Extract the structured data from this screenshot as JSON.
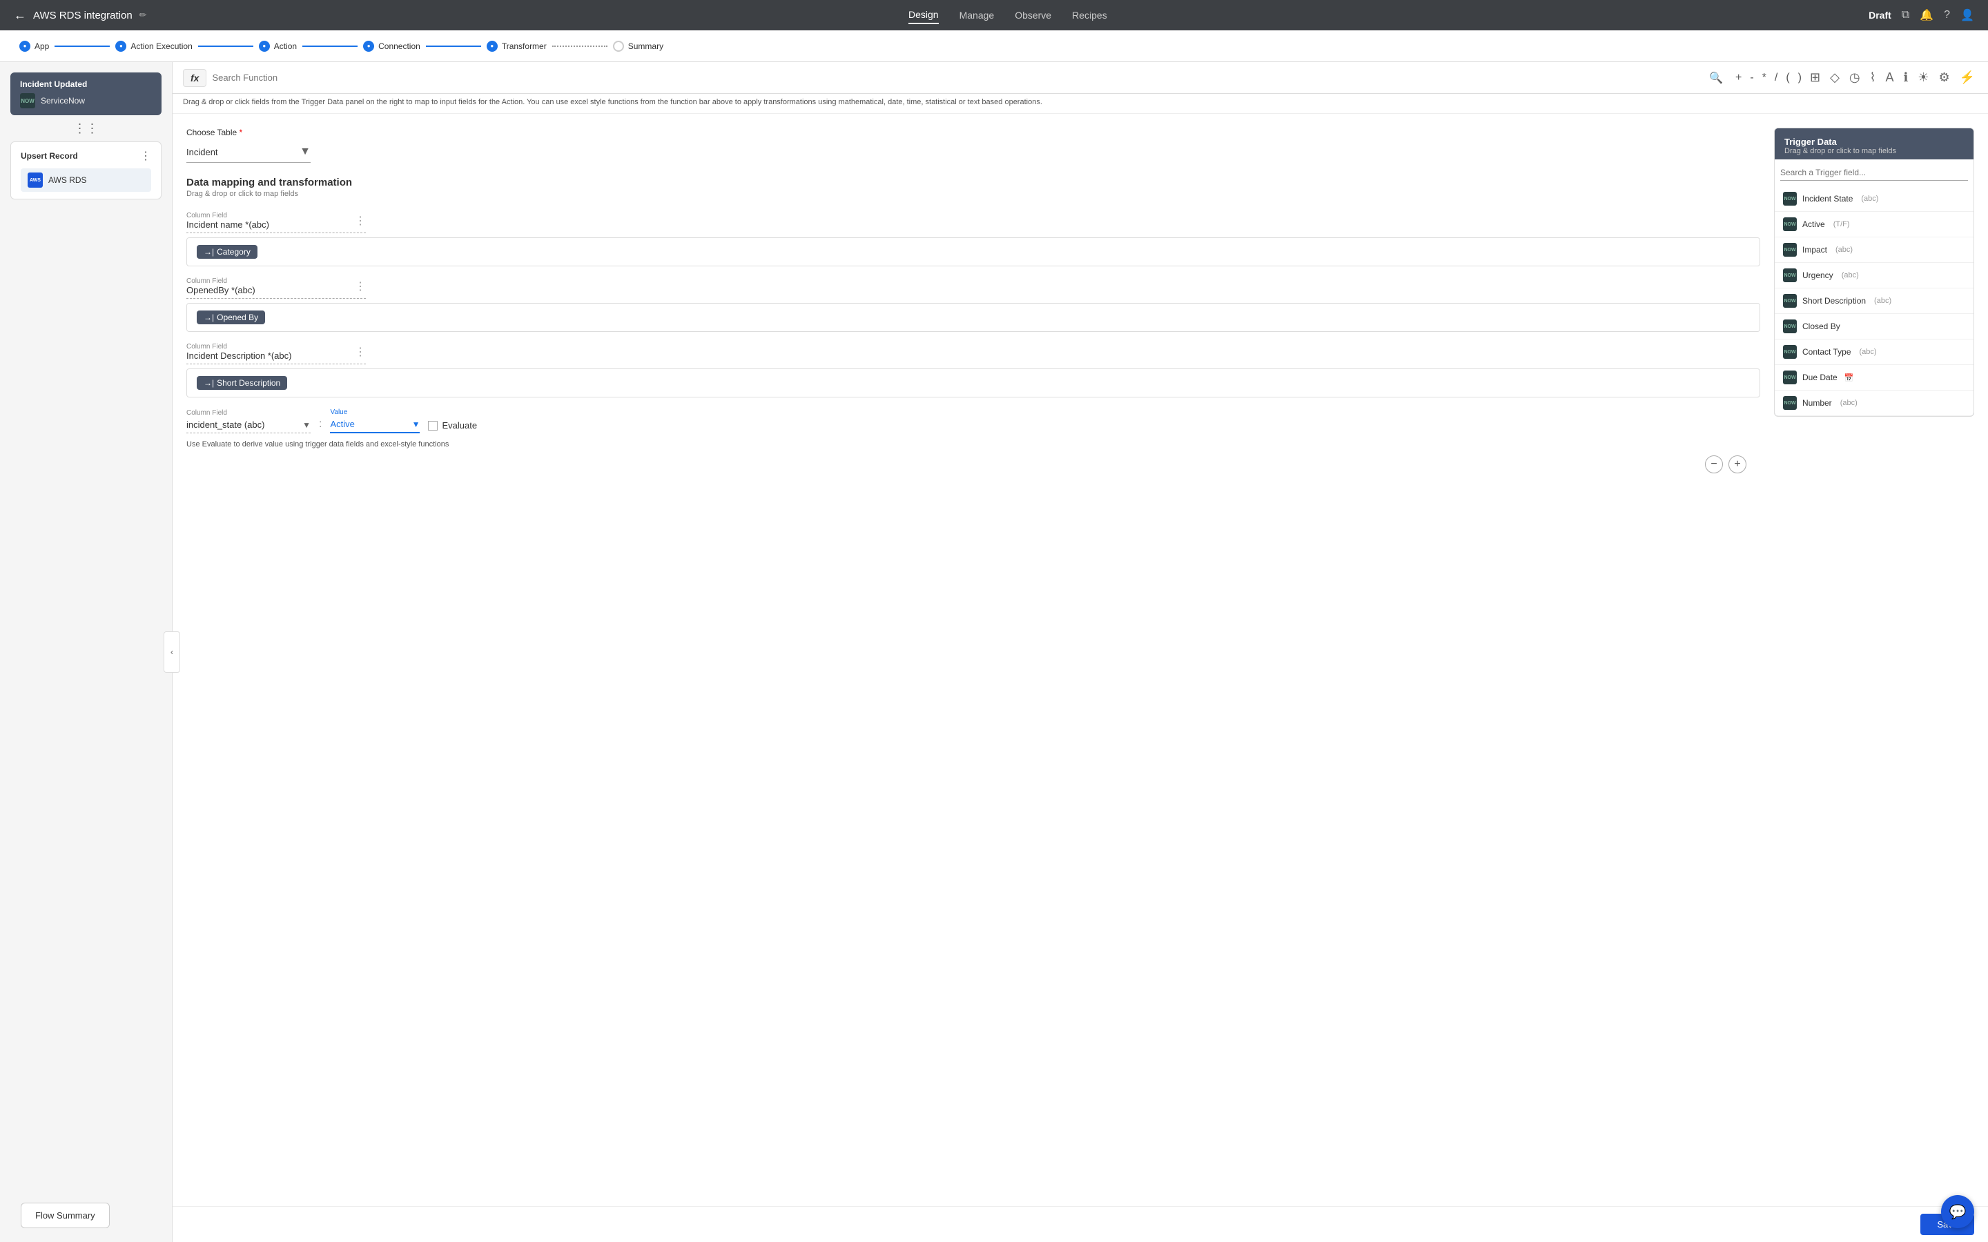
{
  "topNav": {
    "backLabel": "←",
    "appTitle": "AWS RDS integration",
    "editIcon": "✏",
    "tabs": [
      {
        "id": "design",
        "label": "Design",
        "active": true
      },
      {
        "id": "manage",
        "label": "Manage",
        "active": false
      },
      {
        "id": "observe",
        "label": "Observe",
        "active": false
      },
      {
        "id": "recipes",
        "label": "Recipes",
        "active": false
      }
    ],
    "draftLabel": "Draft",
    "icons": [
      "⧉",
      "🔔",
      "?",
      "👤"
    ]
  },
  "stepBar": {
    "steps": [
      {
        "id": "app",
        "label": "App",
        "active": true
      },
      {
        "id": "action-execution",
        "label": "Action Execution",
        "active": true
      },
      {
        "id": "action",
        "label": "Action",
        "active": true
      },
      {
        "id": "connection",
        "label": "Connection",
        "active": true
      },
      {
        "id": "transformer",
        "label": "Transformer",
        "active": true
      },
      {
        "id": "summary",
        "label": "Summary",
        "active": false
      }
    ]
  },
  "leftSidebar": {
    "triggerNode": {
      "title": "Incident Updated",
      "logo": "NOW",
      "label": "ServiceNow"
    },
    "connectorDots": "⋮⋮",
    "upsertNode": {
      "title": "Upsert Record",
      "menuIcon": "⋮",
      "aws": {
        "logo": "AWS",
        "label": "AWS RDS"
      }
    },
    "collapseIcon": "‹"
  },
  "functionBar": {
    "fxLabel": "fx",
    "searchPlaceholder": "Search Function",
    "searchIcon": "🔍",
    "ops": [
      "+",
      "-",
      "*",
      "/",
      "(",
      ")"
    ],
    "tools": [
      "⊞",
      "◇",
      "◷",
      "⌇",
      "A",
      "ℹ",
      "☀",
      "⚙",
      "⚡"
    ]
  },
  "hintBar": {
    "text": "Drag & drop or click fields from the Trigger Data panel on the right to map to input fields for the Action. You can use excel style functions from the function bar above to apply transformations using mathematical, date, time, statistical or text based operations."
  },
  "form": {
    "tableSection": {
      "label": "Choose Table",
      "required": true,
      "value": "Incident",
      "arrowIcon": "▼"
    },
    "dataMappingTitle": "Data mapping and transformation",
    "dataMappingSub": "Drag & drop or click to map fields",
    "mappingRows": [
      {
        "fieldLabel": "Column Field",
        "fieldValue": "Incident name *(abc)",
        "chipLabel": "→| Category"
      },
      {
        "fieldLabel": "Column Field",
        "fieldValue": "OpenedBy *(abc)",
        "chipLabel": "→| Opened By"
      },
      {
        "fieldLabel": "Column Field",
        "fieldValue": "Incident Description *(abc)",
        "chipLabel": "→| Short Description"
      }
    ],
    "valueRow": {
      "fieldLabel": "Column Field",
      "fieldValue": "incident_state (abc)",
      "colon": ":",
      "valueLabel": "Value",
      "activeValue": "Active",
      "evaluateLabel": "Evaluate",
      "hintText": "Use Evaluate to derive value using trigger data fields and excel-style functions"
    },
    "addRemove": {
      "removeIcon": "−",
      "addIcon": "+"
    },
    "saveButton": "Save"
  },
  "triggerPanel": {
    "title": "Trigger Data",
    "subtitle": "Drag & drop or click to map fields",
    "searchPlaceholder": "Search a Trigger field...",
    "fields": [
      {
        "name": "Incident State",
        "type": "(abc)"
      },
      {
        "name": "Active",
        "type": "(T/F)"
      },
      {
        "name": "Impact",
        "type": "(abc)"
      },
      {
        "name": "Urgency",
        "type": "(abc)"
      },
      {
        "name": "Short Description",
        "type": "(abc)"
      },
      {
        "name": "Closed By",
        "type": ""
      },
      {
        "name": "Contact Type",
        "type": "(abc)"
      },
      {
        "name": "Due Date",
        "type": "",
        "icon": "📅"
      },
      {
        "name": "Number",
        "type": "(abc)"
      }
    ]
  },
  "bottomBar": {
    "flowSummaryLabel": "Flow Summary"
  },
  "chatBubble": {
    "icon": "💬"
  }
}
